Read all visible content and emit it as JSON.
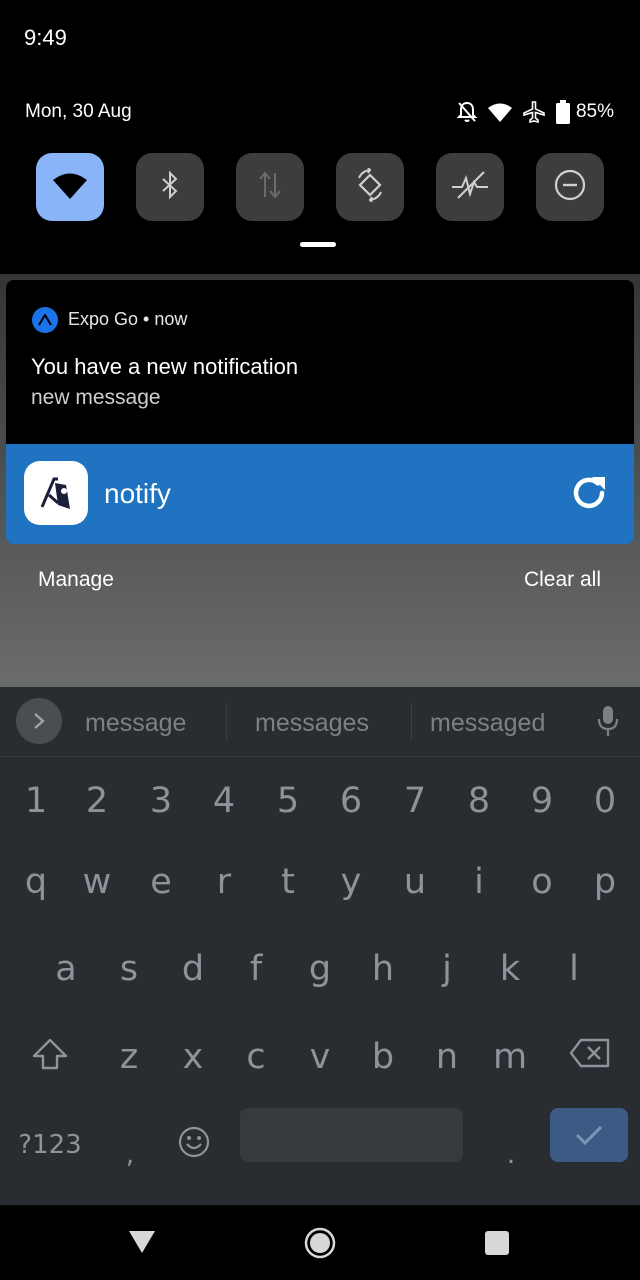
{
  "status_bar": {
    "time": "9:49"
  },
  "quick_settings": {
    "date": "Mon, 30 Aug",
    "battery": "85%",
    "status_icons": [
      "bell-off-icon",
      "wifi-icon",
      "airplane-icon",
      "battery-icon"
    ],
    "tiles": [
      {
        "name": "wifi",
        "icon": "wifi-icon",
        "active": true
      },
      {
        "name": "bluetooth",
        "icon": "bluetooth-icon",
        "active": false
      },
      {
        "name": "mobile-data",
        "icon": "mobile-data-icon",
        "active": false
      },
      {
        "name": "auto-rotate",
        "icon": "auto-rotate-icon",
        "active": false
      },
      {
        "name": "flashlight",
        "icon": "lightning-off-icon",
        "active": false
      },
      {
        "name": "do-not-disturb",
        "icon": "do-not-disturb-icon",
        "active": false
      }
    ]
  },
  "notification": {
    "app_name": "Expo Go",
    "time": "now",
    "header": "Expo Go • now",
    "title": "You have a new notification",
    "body": "new message"
  },
  "media_card": {
    "title": "notify"
  },
  "shade_actions": {
    "manage": "Manage",
    "clear_all": "Clear all"
  },
  "keyboard": {
    "suggestions": [
      "message",
      "messages",
      "messaged"
    ],
    "number_row": [
      "1",
      "2",
      "3",
      "4",
      "5",
      "6",
      "7",
      "8",
      "9",
      "0"
    ],
    "row1": [
      "q",
      "w",
      "e",
      "r",
      "t",
      "y",
      "u",
      "i",
      "o",
      "p"
    ],
    "row2": [
      "a",
      "s",
      "d",
      "f",
      "g",
      "h",
      "j",
      "k",
      "l"
    ],
    "row3": [
      "z",
      "x",
      "c",
      "v",
      "b",
      "n",
      "m"
    ],
    "symbols_key": "?123",
    "comma": ",",
    "period": "."
  },
  "colors": {
    "accent_tile": "#8ab4f8",
    "media_card": "#1f73c0",
    "enter_key": "#3b5b85",
    "keyboard_bg": "#292d32"
  }
}
